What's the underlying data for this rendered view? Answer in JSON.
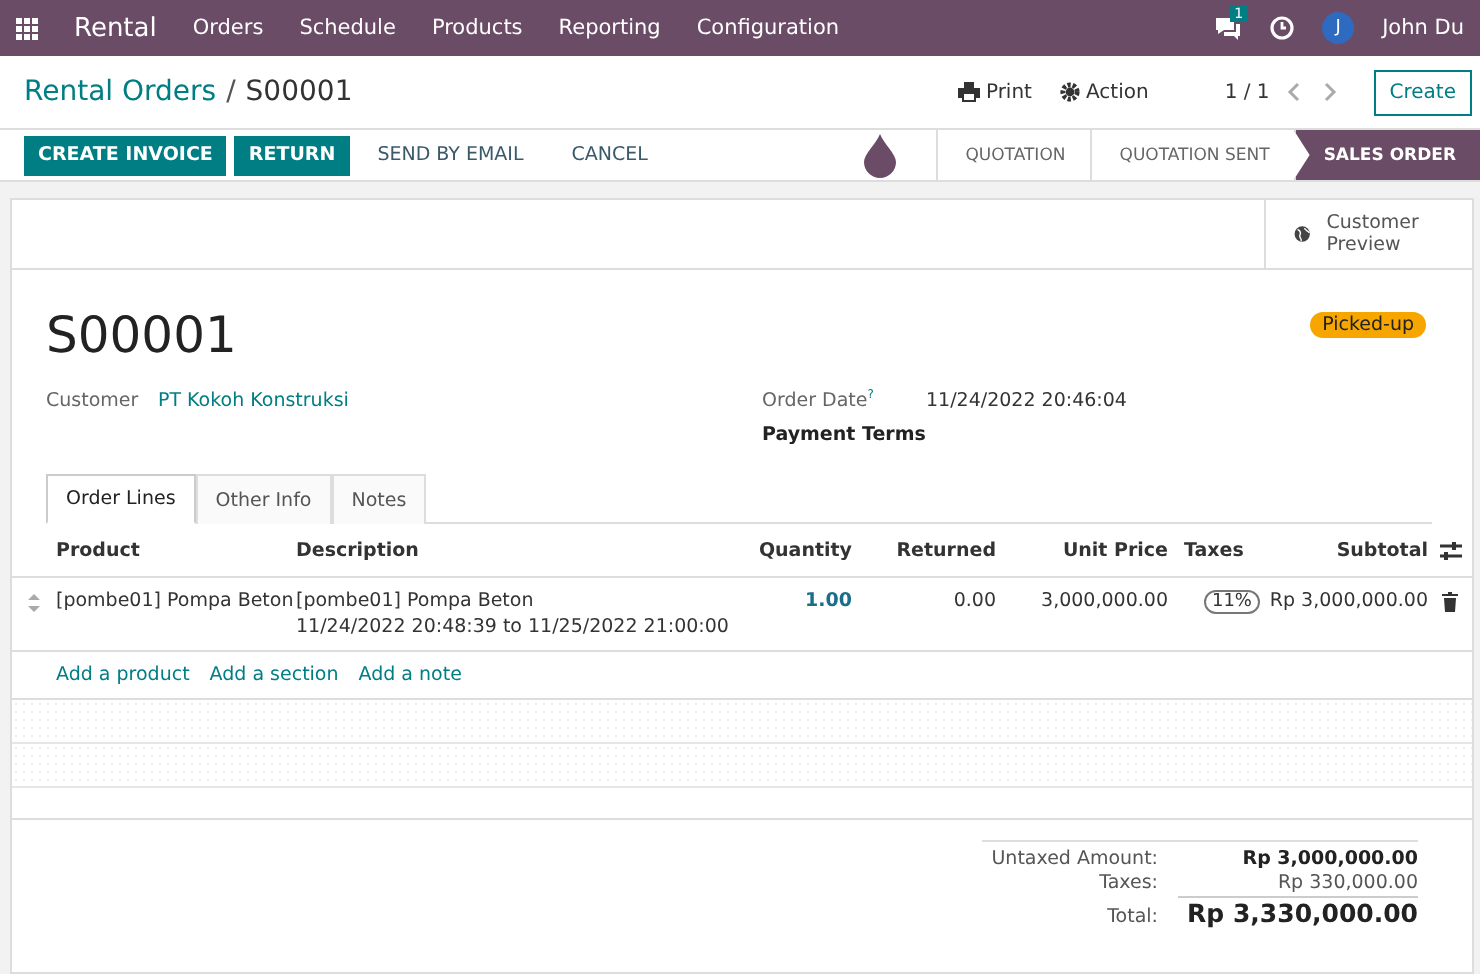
{
  "navbar": {
    "app": "Rental",
    "menu": [
      "Orders",
      "Schedule",
      "Products",
      "Reporting",
      "Configuration"
    ],
    "message_count": "1",
    "user_initial": "J",
    "user_name": "John Du"
  },
  "breadcrumb": {
    "parent": "Rental Orders",
    "separator": "/",
    "current": "S00001"
  },
  "control": {
    "print": "Print",
    "action": "Action",
    "pager": "1 / 1",
    "create": "Create"
  },
  "actions": [
    {
      "label": "CREATE INVOICE",
      "kind": "primary"
    },
    {
      "label": "RETURN",
      "kind": "primary"
    },
    {
      "label": "SEND BY EMAIL",
      "kind": "link"
    },
    {
      "label": "CANCEL",
      "kind": "link"
    }
  ],
  "statusbar": [
    {
      "label": "QUOTATION",
      "selected": false
    },
    {
      "label": "QUOTATION SENT",
      "selected": false
    },
    {
      "label": "SALES ORDER",
      "selected": true
    }
  ],
  "preview_button": "Customer Preview",
  "order": {
    "name": "S00001",
    "badge": "Picked-up",
    "customer_label": "Customer",
    "customer": "PT Kokoh Konstruksi",
    "date_label": "Order Date",
    "date_help": "?",
    "date": "11/24/2022 20:46:04",
    "terms_label": "Payment Terms"
  },
  "tabs": [
    {
      "label": "Order Lines",
      "selected": true
    },
    {
      "label": "Other Info",
      "selected": false
    },
    {
      "label": "Notes",
      "selected": false
    }
  ],
  "table": {
    "columns": [
      "Product",
      "Description",
      "Quantity",
      "Returned",
      "Unit Price",
      "Taxes",
      "Subtotal"
    ],
    "rows": [
      {
        "product": "[pombe01] Pompa Beton",
        "description": "[pombe01] Pompa Beton",
        "period": "11/24/2022 20:48:39 to 11/25/2022 21:00:00",
        "quantity": "1.00",
        "returned": "0.00",
        "unit_price": "3,000,000.00",
        "taxes": "11%",
        "subtotal": "Rp 3,000,000.00"
      }
    ],
    "add_links": [
      "Add a product",
      "Add a section",
      "Add a note"
    ]
  },
  "totals": [
    {
      "label": "Untaxed Amount:",
      "value": "Rp 3,000,000.00",
      "kind": "bold"
    },
    {
      "label": "Taxes:",
      "value": "Rp 330,000.00",
      "kind": "plain"
    },
    {
      "label": "Total:",
      "value": "Rp 3,330,000.00",
      "kind": "grand"
    }
  ]
}
